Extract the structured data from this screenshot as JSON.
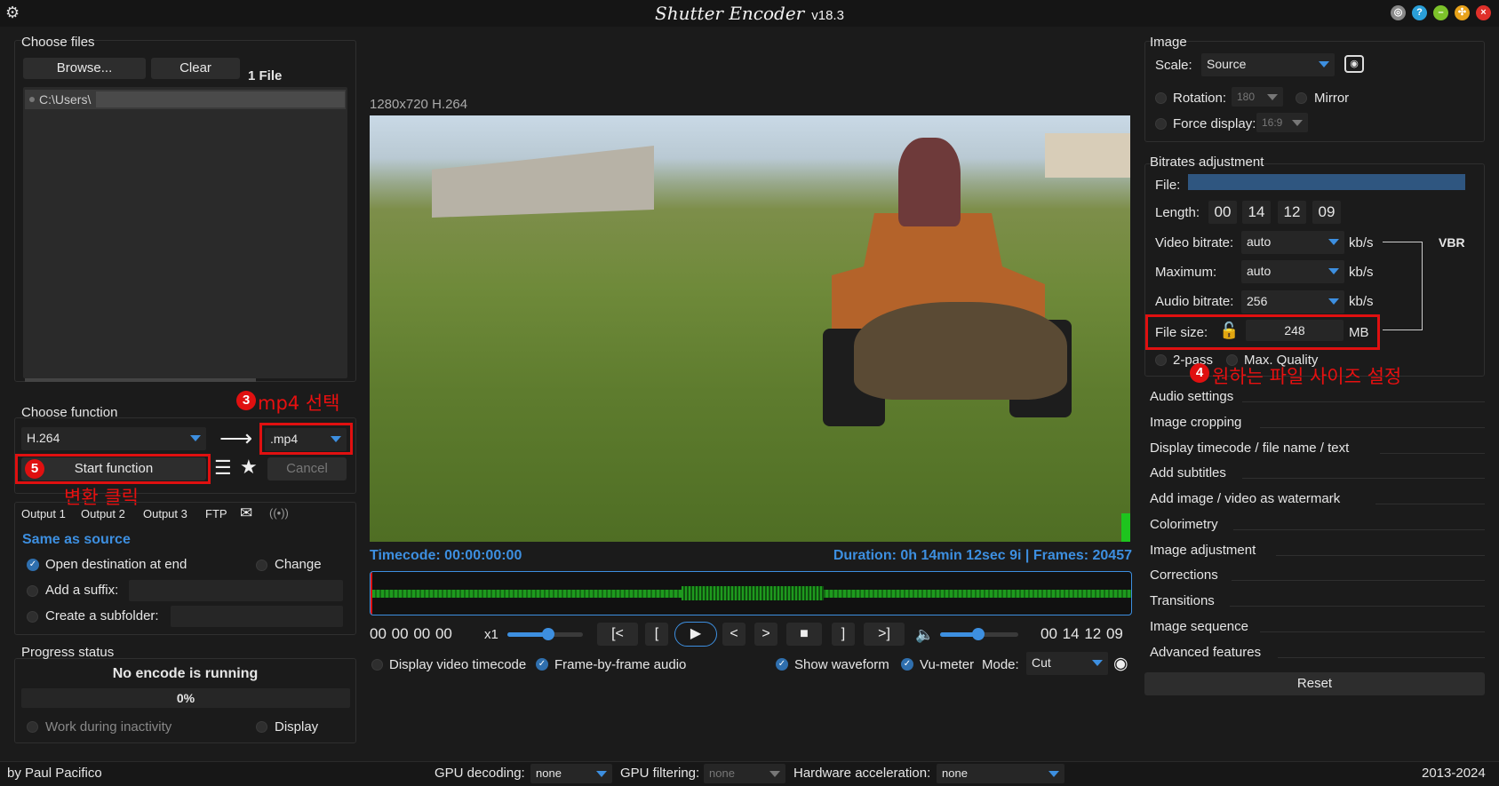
{
  "app": {
    "title": "Shutter Encoder",
    "version": "v18.3"
  },
  "files": {
    "section": "Choose files",
    "browse": "Browse...",
    "clear": "Clear",
    "count": "1 File",
    "item": "C:\\Users\\"
  },
  "func": {
    "section": "Choose function",
    "codec": "H.264",
    "ext": ".mp4",
    "start": "Start function",
    "cancel": "Cancel"
  },
  "annotations": {
    "a3": "mp4 선택",
    "a4": "원하는 파일 사이즈 설정",
    "a5": "변환 클릭",
    "n3": "3",
    "n4": "4",
    "n5": "5"
  },
  "output": {
    "tabs": [
      "Output 1",
      "Output 2",
      "Output 3",
      "FTP"
    ],
    "same": "Same as source",
    "open_dest": "Open destination at end",
    "change": "Change",
    "suffix": "Add a suffix:",
    "subfolder": "Create a subfolder:"
  },
  "progress": {
    "section": "Progress status",
    "status": "No encode is running",
    "percent": "0%",
    "inactivity": "Work during inactivity",
    "display": "Display"
  },
  "player": {
    "info": "1280x720 H.264",
    "timecode": "Timecode: 00:00:00:00",
    "duration": "Duration: 0h 14min 12sec 9i | Frames: 20457",
    "tc_start": [
      "00",
      "00",
      "00",
      "00"
    ],
    "speed": "x1",
    "tc_end": [
      "00",
      "14",
      "12",
      "09"
    ],
    "btn_back": "[<",
    "btn_in": "[",
    "btn_prev": "<",
    "btn_next": ">",
    "btn_out": "]",
    "btn_fwd": ">]",
    "display_tc": "Display video timecode",
    "fbf": "Frame-by-frame audio",
    "waveform": "Show waveform",
    "vumeter": "Vu-meter",
    "mode_label": "Mode:",
    "mode": "Cut"
  },
  "image": {
    "section": "Image",
    "scale_label": "Scale:",
    "scale": "Source",
    "rotation_label": "Rotation:",
    "rotation": "180",
    "mirror": "Mirror",
    "force_label": "Force display:",
    "force": "16:9"
  },
  "bitrates": {
    "section": "Bitrates adjustment",
    "file_label": "File:",
    "length_label": "Length:",
    "length": [
      "00",
      "14",
      "12",
      "09"
    ],
    "video_label": "Video bitrate:",
    "video": "auto",
    "max_label": "Maximum:",
    "max": "auto",
    "audio_label": "Audio bitrate:",
    "audio": "256",
    "unit": "kb/s",
    "vbr": "VBR",
    "size_label": "File size:",
    "size": "248",
    "size_unit": "MB",
    "twopass": "2-pass",
    "maxq": "Max. Quality"
  },
  "accordion": [
    "Audio settings",
    "Image cropping",
    "Display timecode / file name / text",
    "Add subtitles",
    "Add image / video as watermark",
    "Colorimetry",
    "Image adjustment",
    "Corrections",
    "Transitions",
    "Image sequence",
    "Advanced features"
  ],
  "reset": "Reset",
  "footer": {
    "author": "by Paul Pacifico",
    "gpu_dec_label": "GPU decoding:",
    "gpu_dec": "none",
    "gpu_filt_label": "GPU filtering:",
    "gpu_filt": "none",
    "hw_label": "Hardware acceleration:",
    "hw": "none",
    "years": "2013-2024"
  },
  "colors": {
    "accent": "#3d8fe0",
    "annotation": "#e01010",
    "waveform": "#1e9a1e"
  }
}
